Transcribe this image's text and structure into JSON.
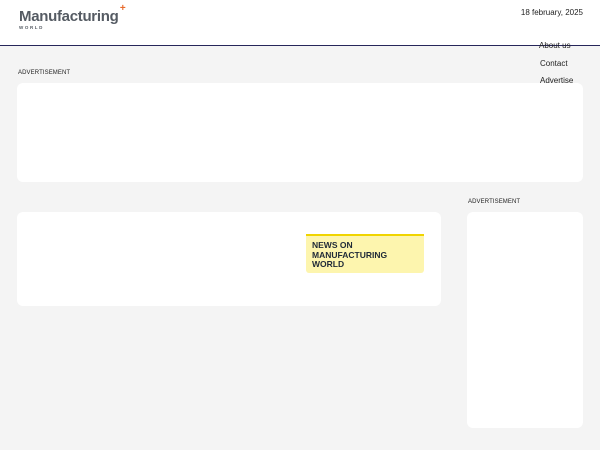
{
  "header": {
    "logo": {
      "main": "Manufacturing",
      "plus": "+",
      "sub": "WORLD"
    },
    "date": "18 february, 2025"
  },
  "nav": {
    "items": [
      {
        "label": "About us"
      },
      {
        "label": "Contact"
      },
      {
        "label": "Advertise"
      }
    ]
  },
  "ads": {
    "top_label": "ADVERTISEMENT",
    "side_label": "ADVERTISEMENT"
  },
  "news": {
    "badge_text": "NEWS ON MANUFACTURING WORLD"
  },
  "colors": {
    "background": "#f4f4f4",
    "header_rule": "#26265a",
    "logo_text": "#555b63",
    "logo_accent": "#e86a2c",
    "badge_bg": "#fdf5ae",
    "badge_border": "#f0d400"
  }
}
